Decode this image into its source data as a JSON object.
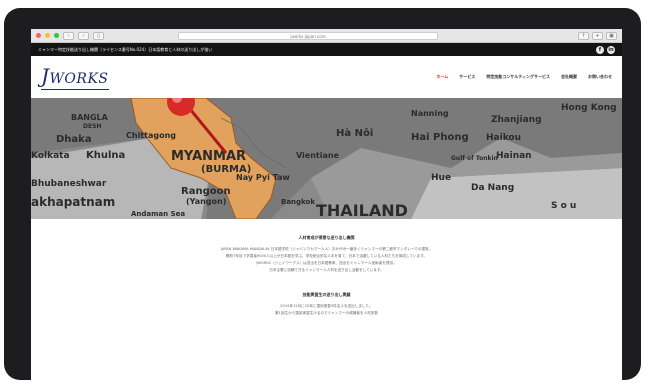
{
  "browser": {
    "url": "jworks-japan.com",
    "traffic_colors": [
      "#ff5f57",
      "#febc2e",
      "#28c840"
    ]
  },
  "topbar": {
    "text": "ミャンマー特定技能送り出し機関（ライセンス番号No.024）日本語教育と人材の送り出しが強い",
    "social": [
      "f",
      "in"
    ]
  },
  "header": {
    "logo_initial": "J",
    "logo_rest": "WORKS",
    "nav": [
      "ホーム",
      "サービス",
      "特定技能コンサルティングサービス",
      "会社概要",
      "お問い合わせ"
    ]
  },
  "hero": {
    "places": [
      "BANGLA",
      "DESH",
      "Dhaka",
      "Kolkata",
      "Khulna",
      "Bhubaneshwar",
      "akhapatnam",
      "Chittagong",
      "MYANMAR",
      "(BURMA)",
      "Nay Pyi Taw",
      "Rangoon",
      "(Yangon)",
      "Andaman Sea",
      "THAILAND",
      "Hà Nôi",
      "Hai Phong",
      "Haikou",
      "Hainan",
      "Hue",
      "Da Nang",
      "Zhanjiang",
      "Hong Kong",
      "Nanning",
      "Vientiane",
      "Bangkok",
      "Gulf of Tonkin",
      "S o u"
    ]
  },
  "section1": {
    "title": "人材育成が得意な送り出し機関",
    "lines": [
      "JAPAN WAKAMA MANDALAY 日本語学校（ジャパンワカマー人人）おかがみ一番多くミャンマーの第二都市マンダレーでの運営。",
      "開校7年目で学習者9000人以上が日本語を学ぶ、学校総合的な人手を育て、日本で活躍している人材たちを育成しています。",
      "JWORKS（ジェイワークス）は送出を日本語教育、送出をミャンマー人技術者を提供。",
      "日本企業に信頼できるミャンマー人人材を送り出し活動をしています。"
    ]
  },
  "section2": {
    "title": "技能実習生の送り出し実績",
    "lines": [
      "2019年12月に25年に運用実習5件名人を送出しました。",
      "第1回生から運用実習生けるのでミャンマーの候補者を人材多数"
    ]
  }
}
